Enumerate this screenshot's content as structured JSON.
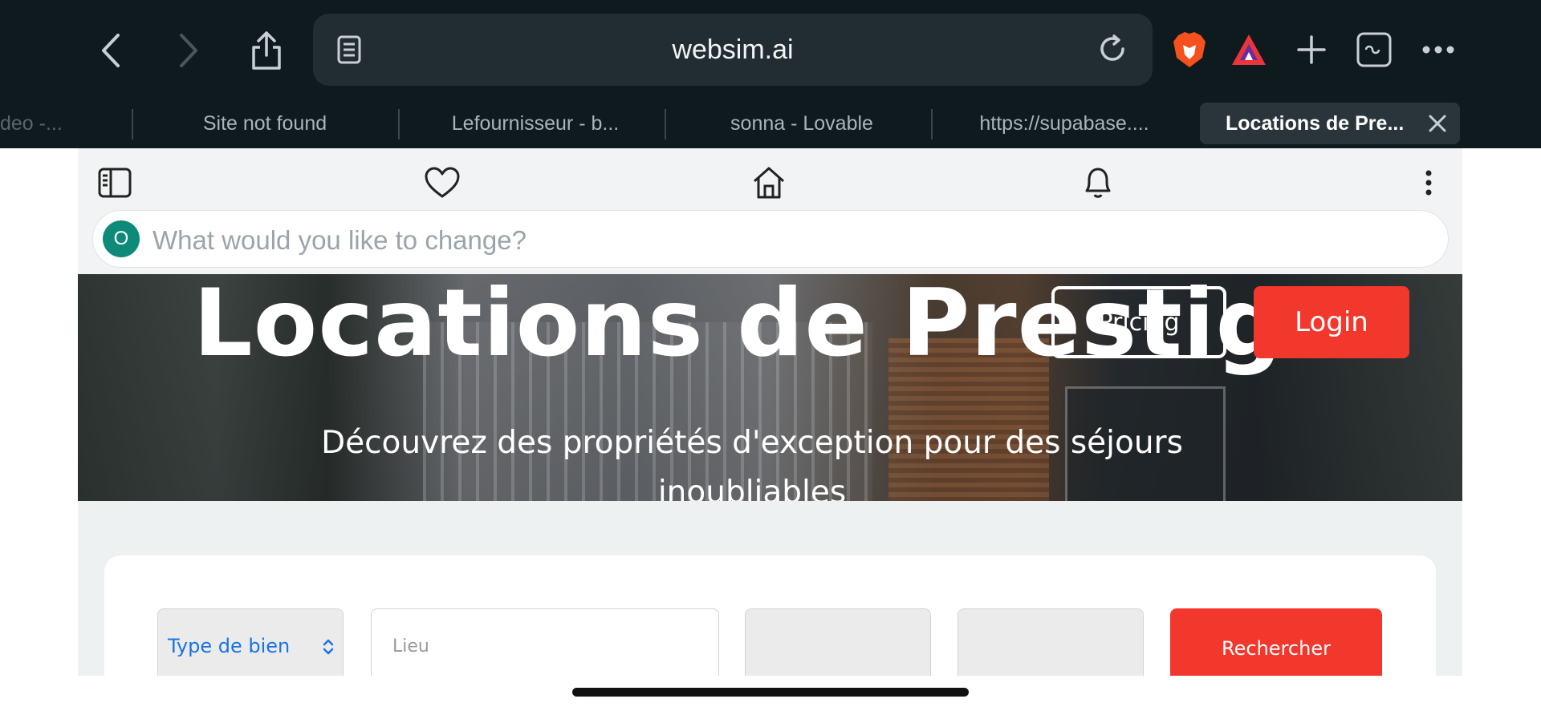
{
  "browser": {
    "url": "websim.ai",
    "tabs": [
      {
        "label": "deo -..."
      },
      {
        "label": "Site not found"
      },
      {
        "label": "Lefournisseur - b..."
      },
      {
        "label": "sonna - Lovable"
      },
      {
        "label": "https://supabase...."
      },
      {
        "label": "Locations de Pre..."
      }
    ],
    "icons": [
      "back-icon",
      "forward-icon",
      "share-icon",
      "reader-icon",
      "reload-icon",
      "brave-lion-icon",
      "brave-rewards-icon",
      "plus-icon",
      "tab-overview-icon",
      "more-icon"
    ]
  },
  "websim": {
    "toolbar_icons": [
      "sidebar-icon",
      "heart-icon",
      "home-icon",
      "bell-icon",
      "kebab-icon"
    ],
    "avatar_initial": "O",
    "prompt_placeholder": "What would you like to change?"
  },
  "hero": {
    "title": "Locations de Prestige",
    "subtitle": "Découvrez des propriétés d'exception pour des séjours inoubliables",
    "pricing_label": "Pricing",
    "login_label": "Login"
  },
  "search": {
    "type_label": "Type de bien",
    "location_placeholder": "Lieu",
    "submit_label": "Rechercher"
  },
  "colors": {
    "accent": "#f2372d",
    "avatar": "#0e8a78",
    "chrome": "#0f1a1f"
  }
}
